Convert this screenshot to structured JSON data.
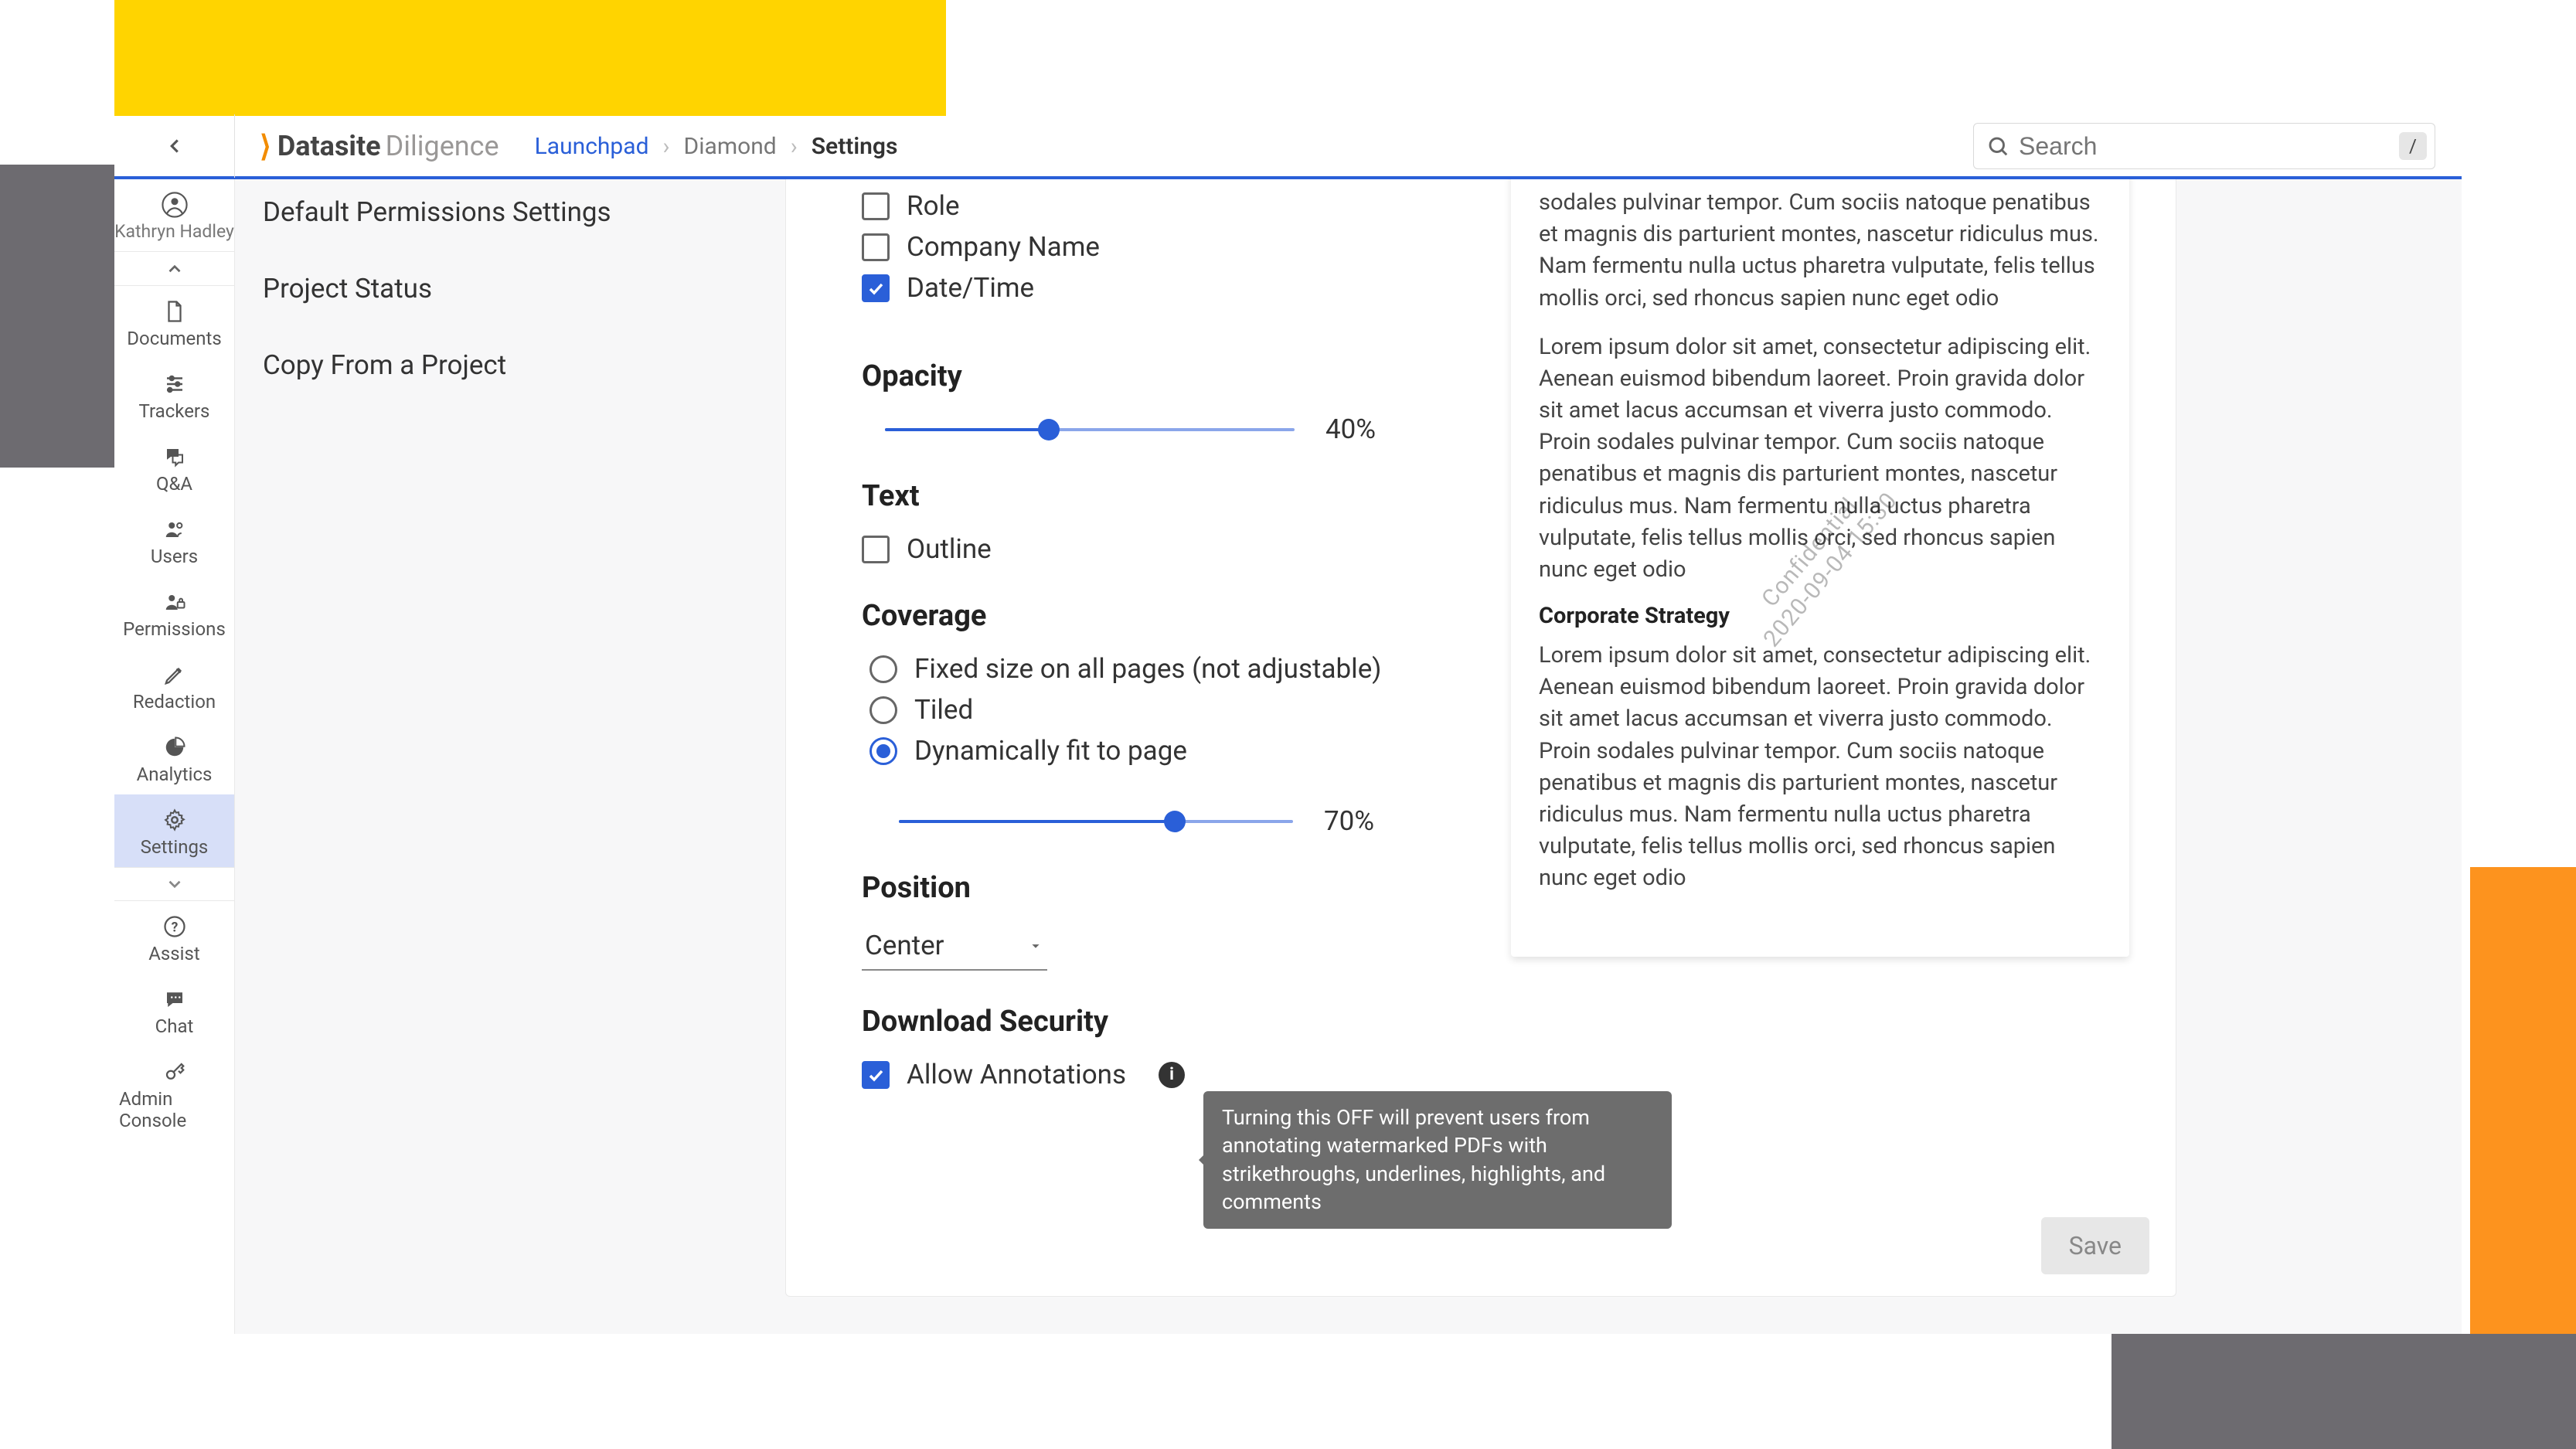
{
  "colors": {
    "accent": "#2a5fd8",
    "brand_orange": "#f28c00",
    "yellow": "#ffd400",
    "orange": "#fd931e",
    "gray_block": "#6d6b70"
  },
  "header": {
    "brand_name": "Datasite",
    "brand_sub": "Diligence",
    "breadcrumbs": [
      "Launchpad",
      "Diamond",
      "Settings"
    ],
    "search_placeholder": "Search",
    "search_shortcut": "/"
  },
  "user": {
    "name": "Kathryn Hadley"
  },
  "sidebar": {
    "items": [
      {
        "key": "documents",
        "label": "Documents",
        "icon": "file-icon"
      },
      {
        "key": "trackers",
        "label": "Trackers",
        "icon": "sliders-icon"
      },
      {
        "key": "qa",
        "label": "Q&A",
        "icon": "chat-icon"
      },
      {
        "key": "users",
        "label": "Users",
        "icon": "users-icon"
      },
      {
        "key": "permissions",
        "label": "Permissions",
        "icon": "user-lock-icon"
      },
      {
        "key": "redaction",
        "label": "Redaction",
        "icon": "pen-icon"
      },
      {
        "key": "analytics",
        "label": "Analytics",
        "icon": "pie-icon"
      },
      {
        "key": "settings",
        "label": "Settings",
        "icon": "gear-icon",
        "active": true
      }
    ],
    "lower": [
      {
        "key": "assist",
        "label": "Assist",
        "icon": "help-icon"
      },
      {
        "key": "chat",
        "label": "Chat",
        "icon": "bubble-icon"
      },
      {
        "key": "admin",
        "label": "Admin Console",
        "icon": "key-icon"
      }
    ]
  },
  "sections": [
    "Default Permissions Settings",
    "Project Status",
    "Copy From a Project"
  ],
  "form": {
    "checkboxes_top": [
      {
        "label": "Role",
        "checked": false
      },
      {
        "label": "Company Name",
        "checked": false
      },
      {
        "label": "Date/Time",
        "checked": true
      }
    ],
    "opacity": {
      "heading": "Opacity",
      "value": 40,
      "display": "40%"
    },
    "text": {
      "heading": "Text",
      "outline_label": "Outline",
      "outline_checked": false
    },
    "coverage": {
      "heading": "Coverage",
      "options": [
        {
          "label": "Fixed size on all pages (not adjustable)",
          "selected": false
        },
        {
          "label": "Tiled",
          "selected": false
        },
        {
          "label": "Dynamically fit to page",
          "selected": true
        }
      ],
      "size_value": 70,
      "size_display": "70%"
    },
    "position": {
      "heading": "Position",
      "value": "Center"
    },
    "download_security": {
      "heading": "Download Security",
      "allow_label": "Allow Annotations",
      "allow_checked": true,
      "tooltip": "Turning this OFF will prevent users from annotating watermarked PDFs with strikethroughs, underlines, highlights, and comments"
    },
    "save_label": "Save"
  },
  "preview": {
    "watermark": "Confidential\n2020-09-04 15:30",
    "para1": "sodales pulvinar tempor. Cum sociis natoque penatibus et magnis dis parturient montes, nascetur ridiculus mus. Nam fermentu nulla uctus pharetra vulputate, felis tellus mollis orci, sed rhoncus sapien nunc eget odio",
    "para2": "Lorem ipsum dolor sit amet, consectetur adipiscing elit. Aenean euismod bibendum laoreet. Proin gravida dolor sit amet lacus accumsan et viverra justo commodo. Proin sodales pulvinar tempor. Cum sociis natoque penatibus et magnis dis parturient montes, nascetur ridiculus mus. Nam fermentu nulla uctus pharetra vulputate, felis tellus mollis orci, sed rhoncus sapien nunc eget odio",
    "heading": "Corporate Strategy",
    "para3": "Lorem ipsum dolor sit amet, consectetur adipiscing elit. Aenean euismod bibendum laoreet. Proin gravida dolor sit amet lacus accumsan et viverra justo commodo. Proin sodales pulvinar tempor. Cum sociis natoque penatibus et magnis dis parturient montes, nascetur ridiculus mus. Nam fermentu nulla uctus pharetra vulputate, felis tellus mollis orci, sed rhoncus sapien nunc eget odio"
  }
}
